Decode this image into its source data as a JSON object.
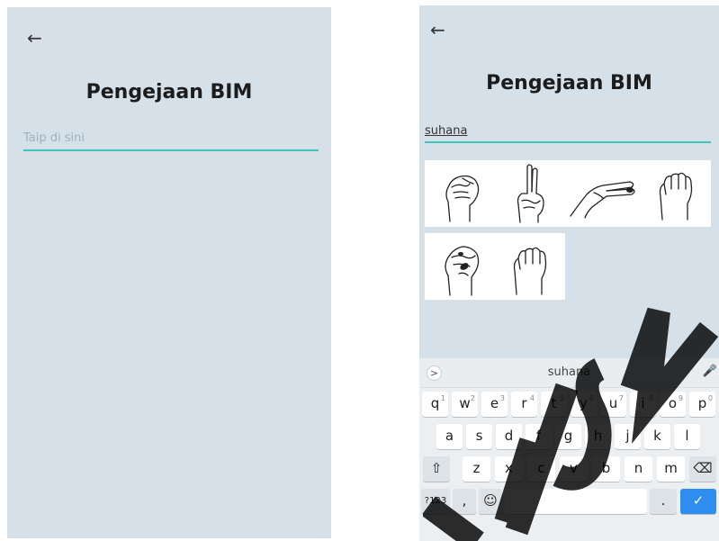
{
  "left_screen": {
    "back_icon": "←",
    "title": "Pengejaan BIM",
    "input_placeholder": "Taip di sini"
  },
  "right_screen": {
    "back_icon": "←",
    "title": "Pengejaan BIM",
    "input_value": "suhana",
    "sign_images": [
      "S",
      "U",
      "H",
      "A",
      "N",
      "A"
    ],
    "keyboard": {
      "suggestion_expand_icon": ">",
      "suggestion": "suhana",
      "mic_icon": "🎤",
      "row1": [
        {
          "k": "q",
          "n": "1"
        },
        {
          "k": "w",
          "n": "2"
        },
        {
          "k": "e",
          "n": "3"
        },
        {
          "k": "r",
          "n": "4"
        },
        {
          "k": "t",
          "n": "5"
        },
        {
          "k": "y",
          "n": "6"
        },
        {
          "k": "u",
          "n": "7"
        },
        {
          "k": "i",
          "n": "8"
        },
        {
          "k": "o",
          "n": "9"
        },
        {
          "k": "p",
          "n": "0"
        }
      ],
      "row2": [
        "a",
        "s",
        "d",
        "f",
        "g",
        "h",
        "j",
        "k",
        "l"
      ],
      "row3": [
        "z",
        "x",
        "c",
        "v",
        "b",
        "n",
        "m"
      ],
      "shift_icon": "⇧",
      "backspace_icon": "⌫",
      "symbols_key": "?123",
      "comma_key": ",",
      "emoji_icon": "☺",
      "period_key": ".",
      "enter_icon": "✓"
    }
  }
}
